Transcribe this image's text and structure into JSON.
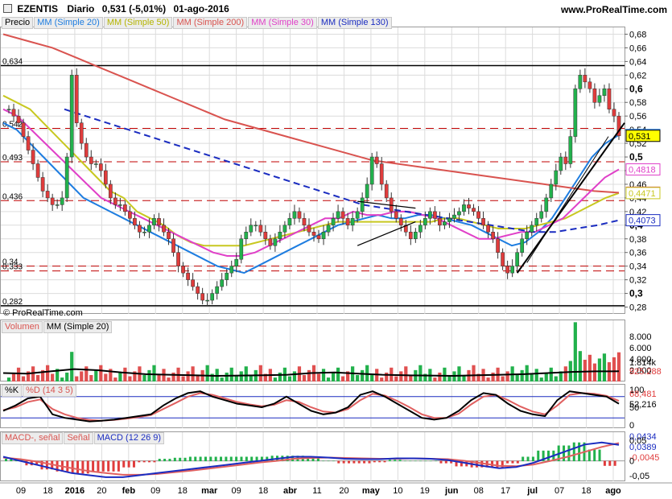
{
  "header": {
    "symbol": "EZENTIS",
    "period": "Diario",
    "price_change": "0,531 (-5,01%)",
    "date": "01-ago-2016",
    "brand": "www.ProRealTime.com",
    "copyright": "© ProRealTime.com"
  },
  "price_legend": [
    "Precio",
    "MM (Simple 20)",
    "MM (Simple 50)",
    "MM (Simple 200)",
    "MM (Simple 30)",
    "MM (Simple 130)"
  ],
  "volume_legend": [
    "Volumen",
    "MM (Simple 20)"
  ],
  "stoch_legend": [
    "%K",
    "%D (14 3 5)"
  ],
  "macd_legend": [
    "MACD-, señal",
    "Señal",
    "MACD (12 26 9)"
  ],
  "colors": {
    "up": "#22b14c",
    "down": "#e03c3c",
    "sma20": "#1e7de0",
    "sma50": "#c8c820",
    "sma200": "#d9534f",
    "sma30": "#e040c8",
    "sma130": "#1a2cc0",
    "grid": "#dcdcdc",
    "support": "#c00000"
  },
  "tags": [
    {
      "label": "0,5323",
      "value": 0.5323,
      "color": "#1e7de0"
    },
    {
      "label": "0,531",
      "value": 0.531,
      "color": "#000000",
      "bg": "#ffff00"
    },
    {
      "label": "0,4818",
      "value": 0.4818,
      "color": "#e040c8"
    },
    {
      "label": "0,4477",
      "value": 0.4477,
      "color": "#d9534f"
    },
    {
      "label": "0,4471",
      "value": 0.4471,
      "color": "#c8c820"
    },
    {
      "label": "0,4073",
      "value": 0.4073,
      "color": "#1a2cc0"
    }
  ],
  "level_labels": [
    {
      "label": "0,634",
      "value": 0.634
    },
    {
      "label": "0,542",
      "value": 0.542
    },
    {
      "label": "0,493",
      "value": 0.493
    },
    {
      "label": "0,436",
      "value": 0.436
    },
    {
      "label": "0,34",
      "value": 0.34
    },
    {
      "label": "0,333",
      "value": 0.333
    },
    {
      "label": "0,282",
      "value": 0.282
    }
  ],
  "chart_data": [
    {
      "type": "candlestick",
      "title": "EZENTIS Diario",
      "ylim": [
        0.27,
        0.69
      ],
      "yticks": [
        "0,28",
        "0,3",
        "0,32",
        "0,34",
        "0,36",
        "0,38",
        "0,4",
        "0,42",
        "0,44",
        "0,46",
        "0,48",
        "0,5",
        "0,52",
        "0,54",
        "0,56",
        "0,58",
        "0,6",
        "0,62",
        "0,64",
        "0,66",
        "0,68"
      ],
      "bold_ticks": [
        "0,3",
        "0,4",
        "0,5",
        "0,6"
      ],
      "xtick_labels": [
        "09",
        "18",
        "2016",
        "20",
        "feb",
        "09",
        "18",
        "mar",
        "09",
        "18",
        "abr",
        "11",
        "20",
        "may",
        "10",
        "19",
        "jun",
        "08",
        "17",
        "jul",
        "07",
        "18",
        "ago"
      ],
      "closes": [
        0.57,
        0.56,
        0.55,
        0.53,
        0.51,
        0.49,
        0.47,
        0.45,
        0.44,
        0.43,
        0.43,
        0.44,
        0.5,
        0.62,
        0.55,
        0.52,
        0.5,
        0.49,
        0.49,
        0.48,
        0.46,
        0.44,
        0.43,
        0.43,
        0.42,
        0.41,
        0.4,
        0.39,
        0.39,
        0.4,
        0.41,
        0.4,
        0.39,
        0.38,
        0.36,
        0.34,
        0.33,
        0.32,
        0.31,
        0.3,
        0.29,
        0.29,
        0.3,
        0.31,
        0.32,
        0.33,
        0.34,
        0.35,
        0.38,
        0.39,
        0.4,
        0.4,
        0.39,
        0.38,
        0.37,
        0.38,
        0.39,
        0.4,
        0.41,
        0.42,
        0.41,
        0.4,
        0.39,
        0.385,
        0.38,
        0.39,
        0.4,
        0.41,
        0.42,
        0.41,
        0.4,
        0.41,
        0.42,
        0.44,
        0.46,
        0.5,
        0.49,
        0.46,
        0.44,
        0.42,
        0.41,
        0.4,
        0.39,
        0.38,
        0.39,
        0.4,
        0.41,
        0.42,
        0.41,
        0.4,
        0.405,
        0.41,
        0.415,
        0.42,
        0.43,
        0.425,
        0.42,
        0.41,
        0.4,
        0.39,
        0.38,
        0.36,
        0.34,
        0.33,
        0.34,
        0.36,
        0.38,
        0.39,
        0.4,
        0.41,
        0.42,
        0.44,
        0.46,
        0.48,
        0.5,
        0.49,
        0.53,
        0.6,
        0.62,
        0.61,
        0.6,
        0.58,
        0.59,
        0.6,
        0.57,
        0.56,
        0.531
      ],
      "series": [
        {
          "name": "MM (Simple 20)",
          "values": [
            0.55,
            0.54,
            0.52,
            0.5,
            0.48,
            0.46,
            0.44,
            0.43,
            0.42,
            0.41,
            0.4,
            0.39,
            0.38,
            0.37,
            0.36,
            0.35,
            0.34,
            0.335,
            0.33,
            0.34,
            0.35,
            0.36,
            0.37,
            0.38,
            0.39,
            0.4,
            0.405,
            0.41,
            0.415,
            0.41,
            0.41,
            0.415,
            0.415,
            0.41,
            0.405,
            0.4,
            0.39,
            0.38,
            0.37,
            0.375,
            0.39,
            0.41,
            0.44,
            0.47,
            0.5,
            0.52,
            0.5323
          ]
        },
        {
          "name": "MM (Simple 50)",
          "values": [
            0.59,
            0.58,
            0.57,
            0.55,
            0.53,
            0.51,
            0.49,
            0.47,
            0.45,
            0.44,
            0.42,
            0.41,
            0.4,
            0.385,
            0.375,
            0.37,
            0.37,
            0.37,
            0.37,
            0.375,
            0.38,
            0.385,
            0.39,
            0.395,
            0.4,
            0.405,
            0.405,
            0.405,
            0.405,
            0.405,
            0.405,
            0.405,
            0.405,
            0.41,
            0.41,
            0.405,
            0.4,
            0.395,
            0.395,
            0.395,
            0.4,
            0.405,
            0.41,
            0.42,
            0.43,
            0.44,
            0.4471
          ]
        },
        {
          "name": "MM (Simple 200)",
          "values": [
            0.68,
            0.67,
            0.66,
            0.645,
            0.63,
            0.615,
            0.6,
            0.585,
            0.57,
            0.555,
            0.545,
            0.535,
            0.525,
            0.515,
            0.505,
            0.495,
            0.49,
            0.485,
            0.48,
            0.475,
            0.47,
            0.465,
            0.46,
            0.455,
            0.45,
            0.4477
          ]
        },
        {
          "name": "MM (Simple 30)",
          "values": [
            0.57,
            0.56,
            0.54,
            0.52,
            0.5,
            0.48,
            0.46,
            0.44,
            0.43,
            0.42,
            0.41,
            0.4,
            0.39,
            0.38,
            0.37,
            0.36,
            0.355,
            0.355,
            0.36,
            0.37,
            0.38,
            0.39,
            0.4,
            0.41,
            0.41,
            0.42,
            0.415,
            0.415,
            0.42,
            0.42,
            0.415,
            0.41,
            0.4,
            0.39,
            0.38,
            0.38,
            0.385,
            0.39,
            0.39,
            0.4,
            0.41,
            0.43,
            0.45,
            0.47,
            0.4818
          ]
        },
        {
          "name": "MM (Simple 130)",
          "values": [
            0.57,
            0.56,
            0.55,
            0.54,
            0.53,
            0.52,
            0.51,
            0.5,
            0.49,
            0.48,
            0.47,
            0.46,
            0.45,
            0.44,
            0.43,
            0.425,
            0.42,
            0.415,
            0.41,
            0.405,
            0.4,
            0.395,
            0.39,
            0.39,
            0.395,
            0.4,
            0.4073
          ]
        }
      ]
    },
    {
      "type": "bar",
      "title": "Volumen",
      "ylim": [
        0,
        10000
      ],
      "yticks": [
        "2.000",
        "4.000",
        "6.000",
        "8.000"
      ],
      "value_labels": [
        "1.814k",
        "925.288"
      ],
      "series": [
        {
          "name": "MM (Simple 20)",
          "values": [
            1500,
            1400,
            1800,
            2200,
            2000,
            1600,
            1300,
            1200,
            1100,
            1000,
            1050,
            1100,
            1200,
            1500,
            1600,
            1400,
            1200,
            1100,
            1050,
            1000,
            1100,
            1200,
            1300,
            1500,
            1700,
            1800,
            1814
          ]
        }
      ]
    },
    {
      "type": "line",
      "title": "%K %D (14 3 5)",
      "ylim": [
        0,
        100
      ],
      "yticks": [
        "0",
        "50",
        "100"
      ],
      "value_labels": [
        "68,481",
        "52,216"
      ],
      "series": [
        {
          "name": "%K",
          "values": [
            40,
            55,
            75,
            80,
            30,
            20,
            15,
            10,
            12,
            15,
            20,
            25,
            30,
            55,
            75,
            90,
            95,
            80,
            70,
            60,
            55,
            50,
            60,
            80,
            60,
            40,
            30,
            35,
            50,
            85,
            95,
            80,
            60,
            40,
            20,
            15,
            20,
            40,
            70,
            90,
            85,
            60,
            40,
            30,
            25,
            70,
            95,
            90,
            85,
            80,
            60
          ]
        },
        {
          "name": "%D",
          "values": [
            42,
            50,
            65,
            72,
            45,
            30,
            20,
            14,
            12,
            14,
            18,
            22,
            28,
            45,
            62,
            80,
            90,
            85,
            75,
            65,
            58,
            53,
            57,
            70,
            65,
            50,
            38,
            35,
            45,
            70,
            88,
            83,
            68,
            50,
            30,
            20,
            20,
            32,
            58,
            80,
            85,
            70,
            52,
            38,
            30,
            55,
            85,
            90,
            88,
            82,
            68
          ]
        }
      ]
    },
    {
      "type": "line",
      "title": "MACD (12 26 9)",
      "ylim": [
        -0.05,
        0.07
      ],
      "value_labels": [
        "0,0434",
        "0,0389",
        "-0,0045"
      ],
      "series": [
        {
          "name": "MACD",
          "values": [
            0.01,
            0.0,
            -0.01,
            -0.02,
            -0.03,
            -0.035,
            -0.04,
            -0.04,
            -0.035,
            -0.03,
            -0.025,
            -0.02,
            -0.015,
            -0.01,
            -0.005,
            0.0,
            0.005,
            0.01,
            0.01,
            0.008,
            0.005,
            0.004,
            0.004,
            0.006,
            0.006,
            0.005,
            0.002,
            -0.005,
            -0.012,
            -0.018,
            -0.015,
            -0.005,
            0.01,
            0.025,
            0.04,
            0.045,
            0.0389
          ]
        },
        {
          "name": "Señal",
          "values": [
            0.008,
            0.004,
            -0.002,
            -0.01,
            -0.018,
            -0.025,
            -0.03,
            -0.034,
            -0.034,
            -0.032,
            -0.028,
            -0.024,
            -0.019,
            -0.014,
            -0.009,
            -0.004,
            0.0,
            0.005,
            0.007,
            0.008,
            0.007,
            0.006,
            0.005,
            0.005,
            0.006,
            0.005,
            0.004,
            0.0,
            -0.006,
            -0.012,
            -0.013,
            -0.009,
            0.0,
            0.01,
            0.022,
            0.034,
            0.0434
          ]
        }
      ]
    }
  ]
}
